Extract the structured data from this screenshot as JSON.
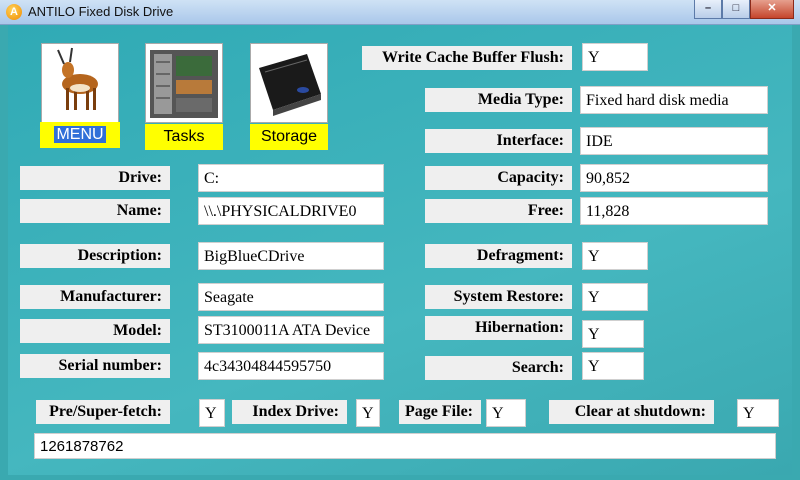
{
  "window": {
    "title": "ANTILO Fixed Disk Drive",
    "icon_letter": "A"
  },
  "nav": {
    "menu": "MENU",
    "tasks": "Tasks",
    "storage": "Storage"
  },
  "fields": {
    "write_cache": {
      "label": "Write Cache Buffer Flush:",
      "value": "Y"
    },
    "media_type": {
      "label": "Media Type:",
      "value": "Fixed hard disk media"
    },
    "interface": {
      "label": "Interface:",
      "value": "IDE"
    },
    "capacity": {
      "label": "Capacity:",
      "value": "90,852"
    },
    "free": {
      "label": "Free:",
      "value": "11,828"
    },
    "drive": {
      "label": "Drive:",
      "value": "C:"
    },
    "name": {
      "label": "Name:",
      "value": "\\\\.\\PHYSICALDRIVE0"
    },
    "description": {
      "label": "Description:",
      "value": "BigBlueCDrive"
    },
    "defragment": {
      "label": "Defragment:",
      "value": "Y"
    },
    "manufacturer": {
      "label": "Manufacturer:",
      "value": "Seagate"
    },
    "system_restore": {
      "label": "System Restore:",
      "value": "Y"
    },
    "model": {
      "label": "Model:",
      "value": "ST3100011A ATA Device"
    },
    "hibernation": {
      "label": "Hibernation:",
      "value": "Y"
    },
    "serial": {
      "label": "Serial number:",
      "value": "4c34304844595750"
    },
    "search": {
      "label": "Search:",
      "value": "Y"
    },
    "prefetch": {
      "label": "Pre/Super-fetch:",
      "value": "Y"
    },
    "index_drive": {
      "label": "Index Drive:",
      "value": "Y"
    },
    "page_file": {
      "label": "Page File:",
      "value": "Y"
    },
    "clear_shutdown": {
      "label": "Clear at shutdown:",
      "value": "Y"
    }
  },
  "status": {
    "value": "1261878762"
  }
}
